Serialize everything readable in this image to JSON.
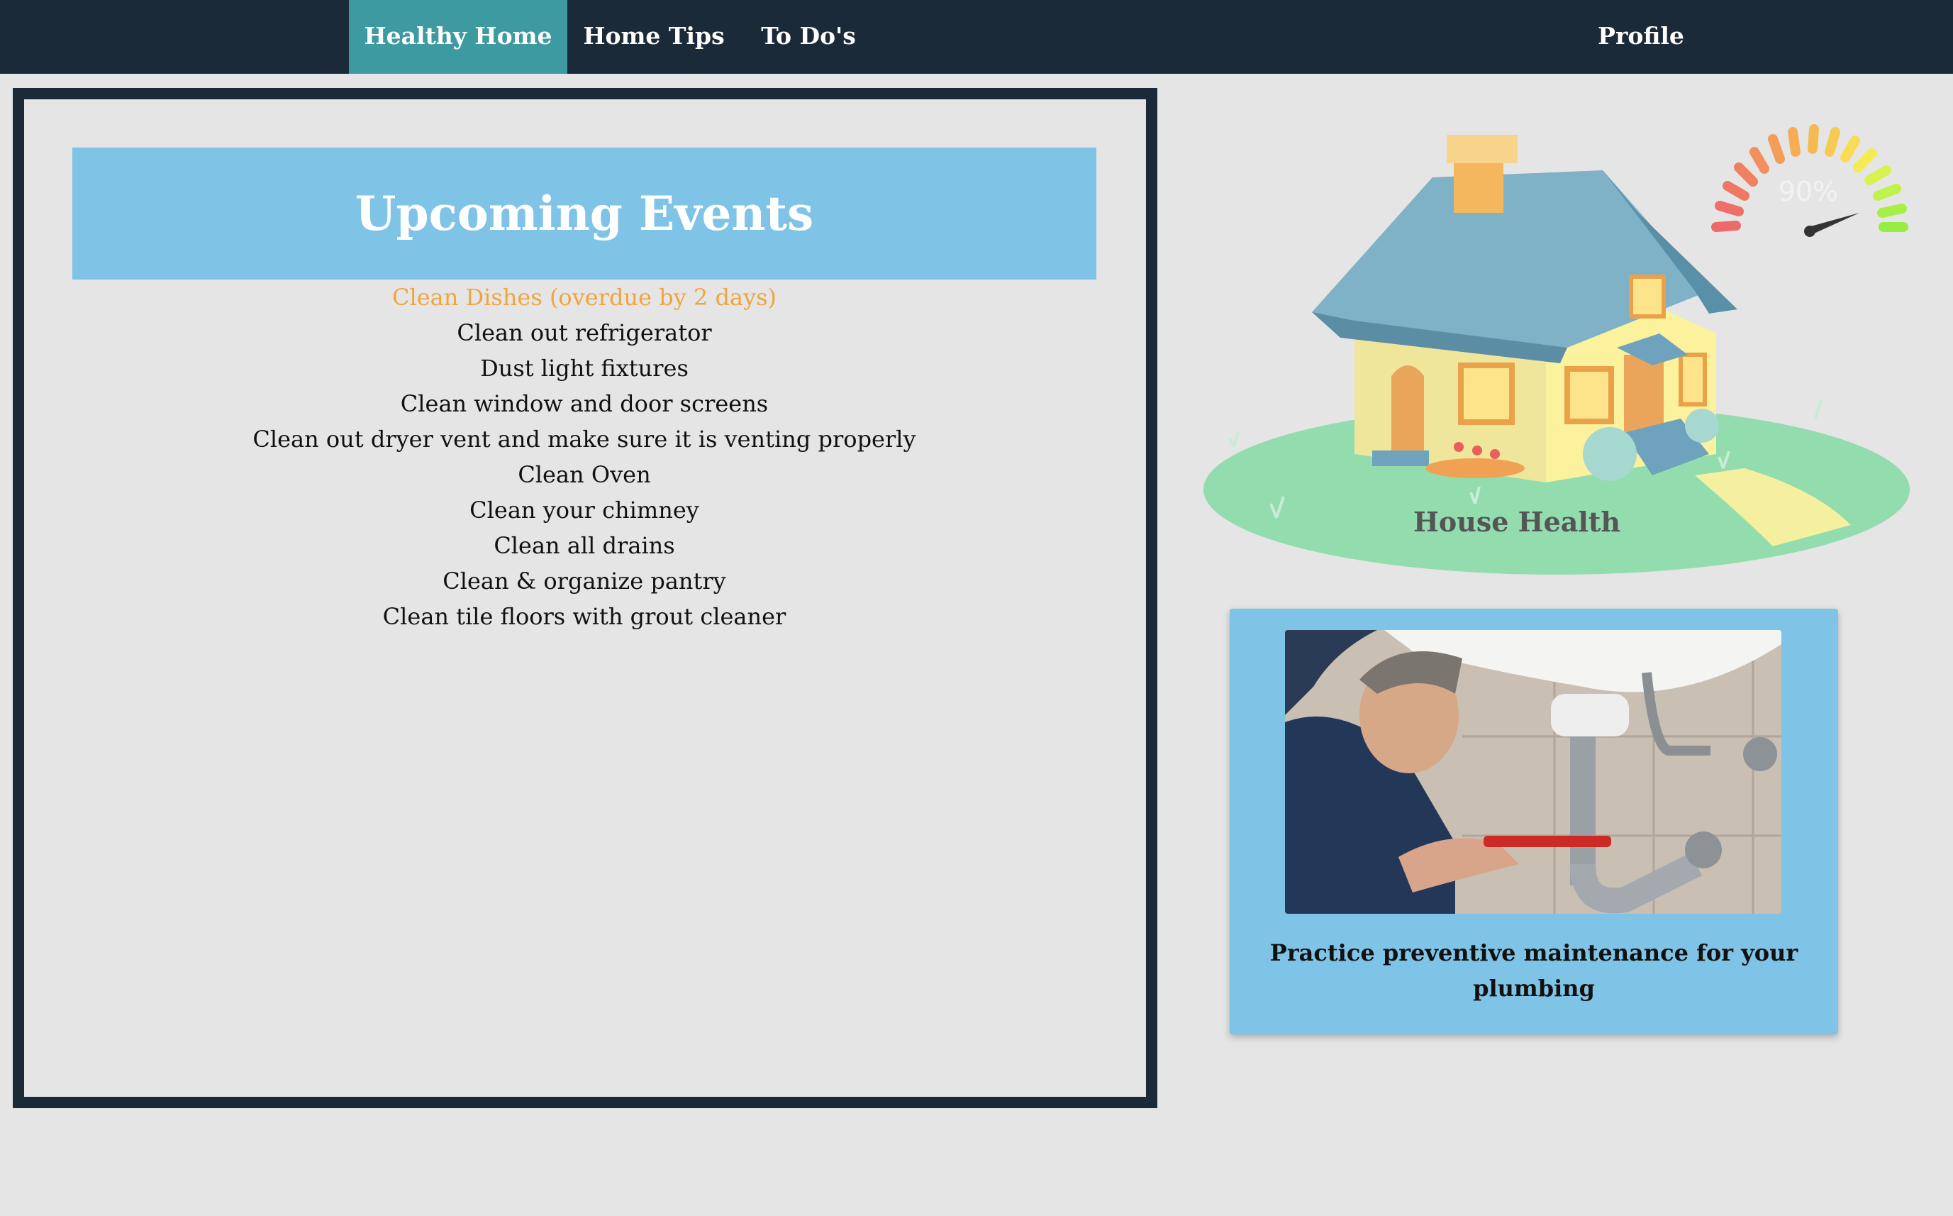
{
  "nav": {
    "items": [
      {
        "label": "Healthy Home",
        "active": true
      },
      {
        "label": "Home Tips",
        "active": false
      },
      {
        "label": "To Do's",
        "active": false
      }
    ],
    "profile_label": "Profile"
  },
  "events": {
    "title": "Upcoming Events",
    "items": [
      {
        "text": "Clean Dishes (overdue by 2 days)",
        "overdue": true
      },
      {
        "text": "Clean out refrigerator",
        "overdue": false
      },
      {
        "text": "Dust light fixtures",
        "overdue": false
      },
      {
        "text": "Clean window and door screens",
        "overdue": false
      },
      {
        "text": "Clean out dryer vent and make sure it is venting properly",
        "overdue": false
      },
      {
        "text": "Clean Oven",
        "overdue": false
      },
      {
        "text": "Clean your chimney",
        "overdue": false
      },
      {
        "text": "Clean all drains",
        "overdue": false
      },
      {
        "text": "Clean & organize pantry",
        "overdue": false
      },
      {
        "text": "Clean tile floors with grout cleaner",
        "overdue": false
      }
    ]
  },
  "health": {
    "label": "House Health",
    "gauge_text": "90%",
    "gauge_value": 0.9
  },
  "tip": {
    "image_icon": "plumber-fixing-sink-photo",
    "text": "Practice preventive maintenance for your plumbing"
  },
  "colors": {
    "nav_bg": "#1a2a38",
    "nav_active": "#3d9aa1",
    "header_blue": "#7fc3e6",
    "overdue": "#f0a53c",
    "page_bg": "#e5e5e5"
  }
}
